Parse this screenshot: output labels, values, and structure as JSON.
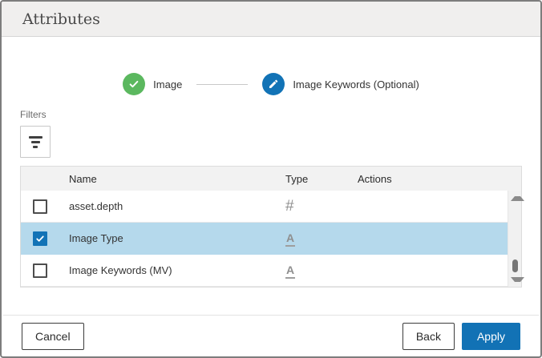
{
  "window": {
    "title": "Attributes"
  },
  "stepper": {
    "steps": [
      {
        "label": "Image",
        "state": "complete",
        "icon": "check-icon"
      },
      {
        "label": "Image Keywords (Optional)",
        "state": "current",
        "icon": "pencil-icon"
      }
    ]
  },
  "filters": {
    "label": "Filters"
  },
  "table": {
    "columns": {
      "name": "Name",
      "type": "Type",
      "actions": "Actions"
    },
    "rows": [
      {
        "name": "asset.depth",
        "checked": false,
        "selected": false,
        "type": "number",
        "type_glyph": "#"
      },
      {
        "name": "Image Type",
        "checked": true,
        "selected": true,
        "type": "text",
        "type_glyph": "A"
      },
      {
        "name": "Image Keywords (MV)",
        "checked": false,
        "selected": false,
        "type": "text",
        "type_glyph": "A"
      }
    ]
  },
  "footer": {
    "cancel": "Cancel",
    "back": "Back",
    "apply": "Apply"
  },
  "colors": {
    "accent_blue": "#1273b6",
    "success_green": "#5bb85f",
    "row_highlight": "#b5d9ec",
    "titlebar_bg": "#f0efee",
    "table_header_bg": "#f2f2f2"
  }
}
